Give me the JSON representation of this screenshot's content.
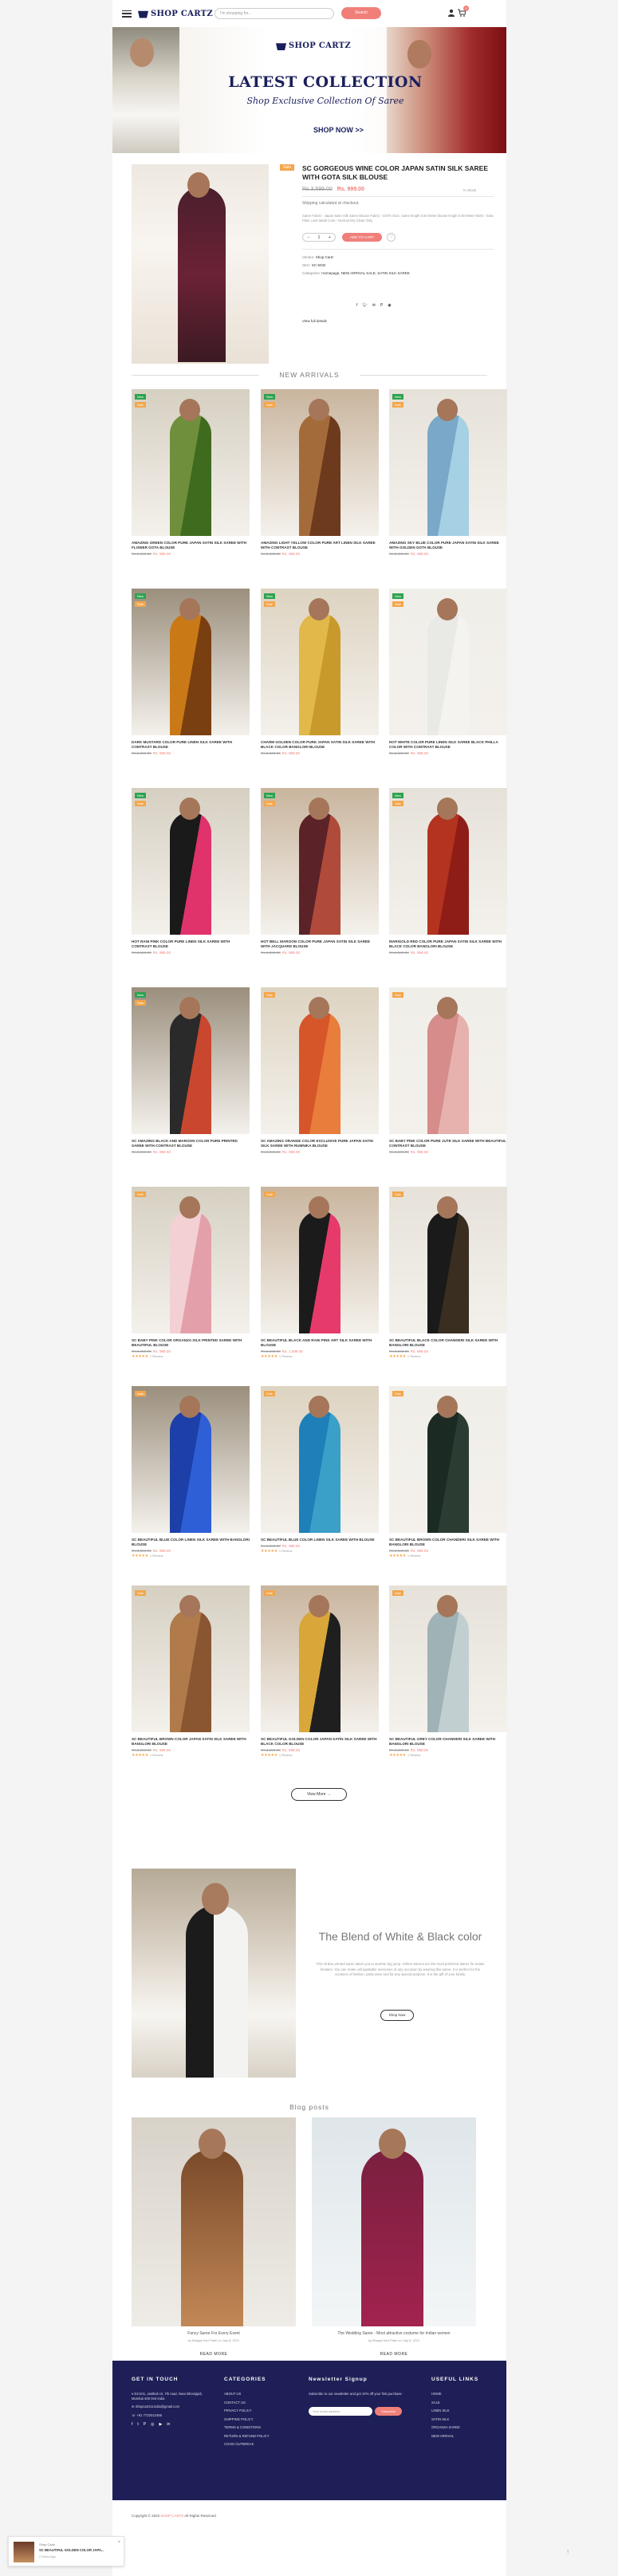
{
  "header": {
    "logo": "SHOP CARTZ",
    "search_placeholder": "I'm shopping for...",
    "search_button": "Search",
    "cart_count": "0"
  },
  "banner": {
    "logo": "SHOP CARTZ",
    "title": "LATEST COLLECTION",
    "subtitle": "Shop Exclusive Collection Of Saree",
    "cta": "SHOP NOW >>"
  },
  "product_detail": {
    "badge": "Sale",
    "title": "Sc Gorgeous Wine Color Japan Satin Silk Saree With Gota Silk Blouse",
    "old_price": "Rs.3,599.00",
    "price": "Rs. 999.00",
    "stock": "In Stock",
    "shipping": "Shipping calculated at checkout.",
    "description": "Saree Fabric:- Japan Satin Silk Saree Blouse Fabric:- GOTA SILK. saree length 5.50 Meter blouse length 0.80 Meter Work:- Gota Plain Look Wash Care:- Normal Dry Clean Only",
    "qty": "1",
    "add_to_cart": "ADD TO CART",
    "vendor_label": "Vendor:",
    "vendor": "Shop Cartz",
    "sku_label": "SKU:",
    "sku": "SC-5032",
    "categories_label": "Categories:",
    "categories": "Homepage, NEW ARRIVAL SALE, SATIN SILK SAREE",
    "full_details": "View full details"
  },
  "new_arrivals": {
    "heading": "NEW ARRIVALS",
    "products": [
      {
        "name": "Amazing Green Color Pure Japan Satin Silk Saree With Flower Gota Blouse",
        "old": "Rs.3,699.00",
        "price": "Rs. 999.00",
        "badges": [
          "new",
          "sale"
        ],
        "tone": "green",
        "stars": ""
      },
      {
        "name": "Amazing Light Yellow Color Pure Art Linen Silk Saree With Contrast Blouse",
        "old": "Rs.3,699.00",
        "price": "Rs. 999.00",
        "badges": [
          "new",
          "sale"
        ],
        "tone": "brown",
        "stars": ""
      },
      {
        "name": "Amazing Sky Blue Color Pure Japan Satin Silk Saree With Golden Gota Blouse",
        "old": "Rs.3,699.00",
        "price": "Rs. 999.00",
        "badges": [
          "new",
          "sale"
        ],
        "tone": "sky",
        "stars": ""
      },
      {
        "name": "Dark Mustard Color Pure Linen Silk Saree With Contrast Blouse",
        "old": "Rs.3,699.00",
        "price": "Rs. 999.00",
        "badges": [
          "new",
          "sale"
        ],
        "tone": "mustard",
        "stars": ""
      },
      {
        "name": "Charm Golden Color Pure Japan Satin Silk Saree With Black Color Banglori Blouse",
        "old": "Rs.3,699.00",
        "price": "Rs. 999.00",
        "badges": [
          "new",
          "sale"
        ],
        "tone": "gold",
        "stars": ""
      },
      {
        "name": "Hot White Color Pure Linen Silk Saree Black Philla Color With Contrast Blouse",
        "old": "Rs.3,699.00",
        "price": "Rs. 999.00",
        "badges": [
          "new",
          "sale"
        ],
        "tone": "white",
        "stars": ""
      },
      {
        "name": "Hot Rani Pink Color Pure Linen Silk Saree With Contrast Blouse",
        "old": "Rs.3,699.00",
        "price": "Rs. 999.00",
        "badges": [
          "new",
          "sale"
        ],
        "tone": "pinkblack",
        "stars": ""
      },
      {
        "name": "Hot Bell Maroon Color Pure Japan Satin Silk Saree With Jacquard Blouse",
        "old": "Rs.3,699.00",
        "price": "Rs. 999.00",
        "badges": [
          "new",
          "sale"
        ],
        "tone": "maroon",
        "stars": ""
      },
      {
        "name": "Marigold Red Color Pure Japan Satin Silk Saree With Black Color Banglori Blouse",
        "old": "Rs.3,699.00",
        "price": "Rs. 999.00",
        "badges": [
          "new",
          "sale"
        ],
        "tone": "red",
        "stars": ""
      },
      {
        "name": "Sc Amazing Black And Maroon Color Pure Printed Saree With Contrast Blouse",
        "old": "Rs.3,699.00",
        "price": "Rs. 999.00",
        "badges": [
          "new",
          "sale"
        ],
        "tone": "stripe",
        "stars": ""
      },
      {
        "name": "Sc Amazing Orange Color Exclusive Pure Japan Satin Silk Saree With Rumnika Blouse",
        "old": "Rs.3,699.00",
        "price": "Rs. 999.00",
        "badges": [
          "sale"
        ],
        "tone": "orange",
        "stars": ""
      },
      {
        "name": "Sc Baby Pink Color Pure Jute Silk Saree With Beautiful Contrast Blouse",
        "old": "Rs.3,699.00",
        "price": "Rs. 999.00",
        "badges": [
          "sale"
        ],
        "tone": "babypink",
        "stars": ""
      },
      {
        "name": "Sc Baby Pink Color Organza Silk Printed Saree With Beautiful Blouse",
        "old": "Rs.3,699.00",
        "price": "Rs. 999.00",
        "badges": [
          "sale"
        ],
        "tone": "floral",
        "stars": "★★★★★ 1 Review"
      },
      {
        "name": "Sc Beautiful Black And Rani Pink Art Silk Saree With Blouse",
        "old": "Rs.3,699.00",
        "price": "Rs. 1,099.00",
        "badges": [
          "sale"
        ],
        "tone": "pinkblack2",
        "stars": "★★★★★ 1 Review"
      },
      {
        "name": "Sc Beautiful Black Color Chanderi Silk Saree With Banglori Blouse",
        "old": "Rs.3,699.00",
        "price": "Rs. 999.00",
        "badges": [
          "sale"
        ],
        "tone": "black",
        "stars": "★★★★★ 1 Review"
      },
      {
        "name": "Sc Beautiful Blue Color Linen Silk Saree With Banglori Blouse",
        "old": "Rs.3,699.00",
        "price": "Rs. 999.00",
        "badges": [
          "sale"
        ],
        "tone": "blue",
        "stars": "★★★★★ 1 Review"
      },
      {
        "name": "Sc Beautiful Blue Color Linen Silk Saree With Blouse",
        "old": "Rs.3,699.00",
        "price": "Rs. 999.00",
        "badges": [
          "sale"
        ],
        "tone": "teal",
        "stars": "★★★★★ 1 Review"
      },
      {
        "name": "Sc Beautiful Brown Color Chanderi Silk Saree With Banglori Blouse",
        "old": "Rs.3,699.00",
        "price": "Rs. 999.00",
        "badges": [
          "sale"
        ],
        "tone": "darkgreen",
        "stars": "★★★★★ 1 Review"
      },
      {
        "name": "Sc Beautiful Brown Color Japan Satin Silk Saree With Banglori Blouse",
        "old": "Rs.3,699.00",
        "price": "Rs. 999.00",
        "badges": [
          "sale"
        ],
        "tone": "copper",
        "stars": "★★★★★ 1 Review"
      },
      {
        "name": "Sc Beautiful Golden Color Japan Satin Silk Saree With Black Color Blouse",
        "old": "Rs.3,699.00",
        "price": "Rs. 999.00",
        "badges": [
          "sale"
        ],
        "tone": "gold2",
        "stars": "★★★★★ 1 Review"
      },
      {
        "name": "Sc Beautiful Grey Color Chanderi Silk Saree With Banglori Blouse",
        "old": "Rs.3,699.00",
        "price": "Rs. 999.00",
        "badges": [
          "sale"
        ],
        "tone": "grey",
        "stars": "★★★★★ 1 Review"
      }
    ],
    "view_more": "View More"
  },
  "promo": {
    "title": "The Blend of White & Black color",
    "text": "This Online printed saree takes you to another big jump. Online Sarees are the most preferred attires for Indian females. You can make unforgettable memories of any occasion by wearing this saree. It is perfect for the occasion of fashion, party wear and for any special purpose. It is the gift of your family.",
    "button": "Shop Now"
  },
  "blog": {
    "heading": "Blog posts",
    "posts": [
      {
        "title": "Fancy Saree For Every Event",
        "meta": "by Bhagat Karl Patel  on  July 8, 2021",
        "read_more": "READ MORE",
        "tone": "bronze"
      },
      {
        "title": "The Wedding Saree - Most attractive costume for Indian women",
        "meta": "by Bhagat Karl Patel  on  July 8, 2021",
        "read_more": "READ MORE",
        "tone": "magenta"
      }
    ]
  },
  "footer": {
    "get_in_touch": {
      "heading": "GET IN TOUCH",
      "address": "D1/101, Jasthali cir, 7th road, Near Bhomjipdi, Mumbai 400 044 India",
      "email": "Shopcartz11india@gmail.com",
      "phone": "+91 7722012458"
    },
    "categories": {
      "heading": "CATEGORIES",
      "items": [
        "ABOUT US",
        "CONTACT US",
        "PRIVACY POLICY",
        "SHIPPING POLICY",
        "TERMS & CONDITIONS",
        "RETURN & REFUND POLICY",
        "COVID OUTBREAK"
      ]
    },
    "newsletter": {
      "heading": "Newsletter Signup",
      "text": "Subscribe to our newsletter and get 10% off your first purchase",
      "placeholder": "Your email address",
      "button": "Subscribe"
    },
    "useful_links": {
      "heading": "USEFUL LINKS",
      "items": [
        "HOME",
        "SALE",
        "LINEN SILK",
        "SATIN SILK",
        "ORGANZA SAREE",
        "NEW ARRIVAL"
      ]
    },
    "copyright_prefix": "Copyright © 2022 ",
    "copyright_brand": "SHOP CARTZ",
    "copyright_suffix": " All Rights Reserved"
  },
  "toast": {
    "line1": "Shop Cartz",
    "line2": "SC BEAUTIFUL GOLDEN COLOR JAPA...",
    "line3": "2 Hours Ago"
  }
}
